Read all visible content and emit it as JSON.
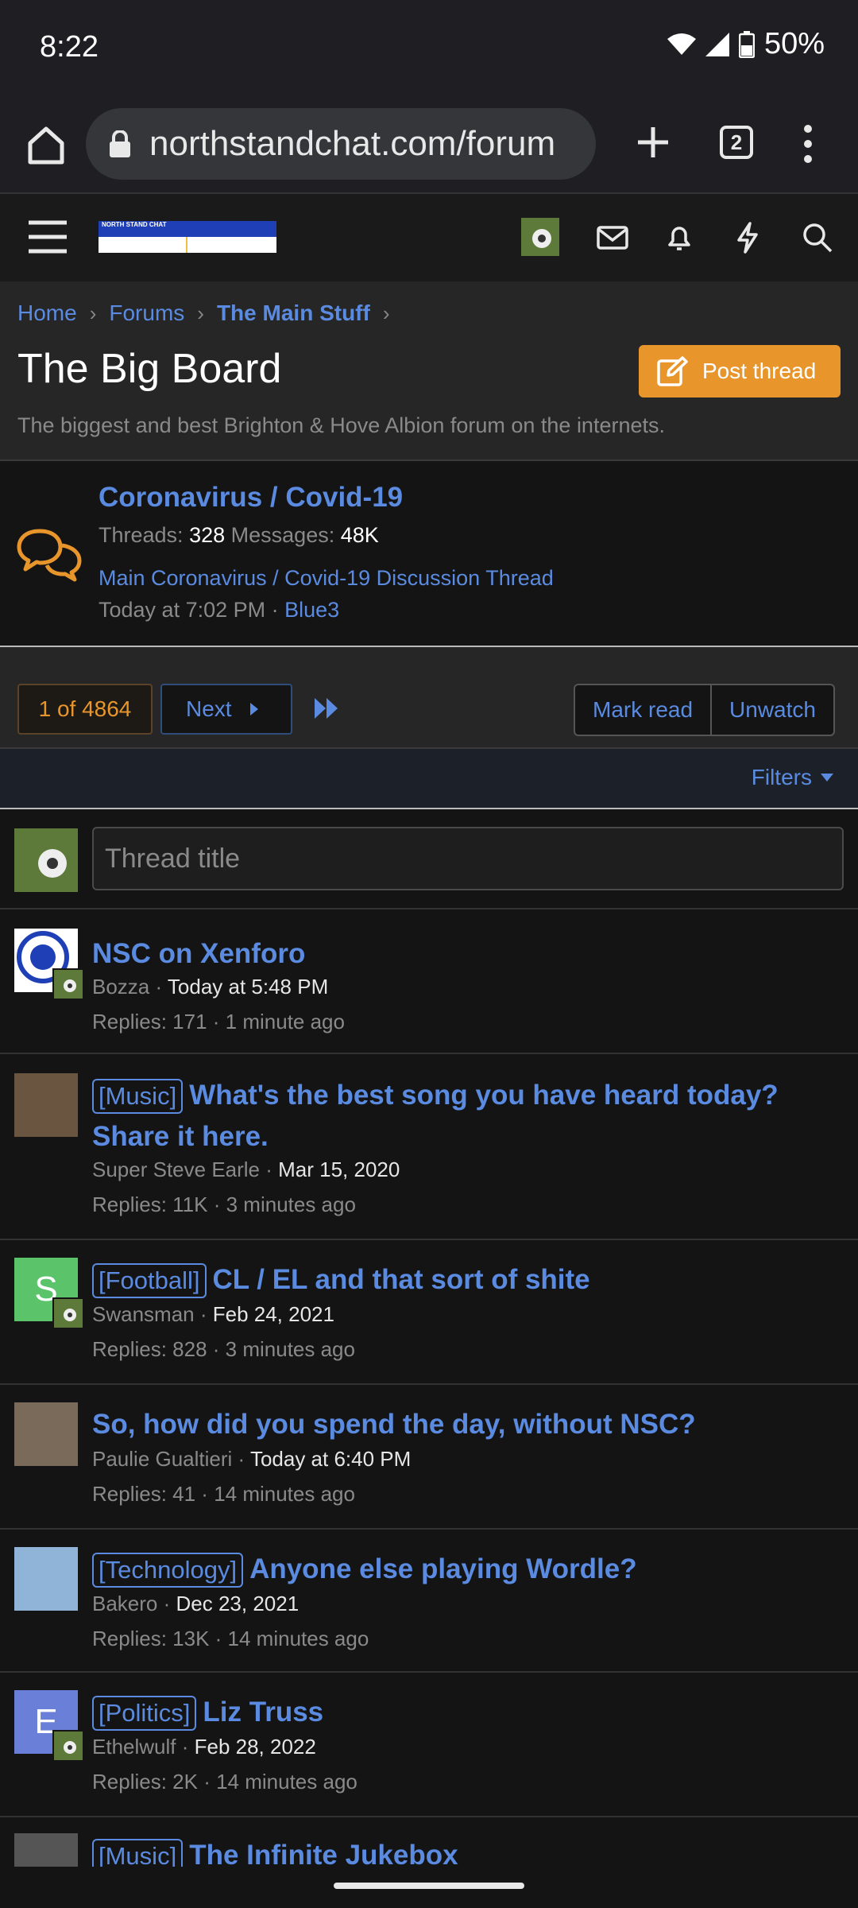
{
  "status": {
    "time": "8:22",
    "battery": "50%"
  },
  "browser": {
    "url": "northstandchat.com/forum",
    "tab_count": "2"
  },
  "header": {
    "logo_text": "NORTH STAND CHAT"
  },
  "breadcrumbs": [
    "Home",
    "Forums",
    "The Main Stuff"
  ],
  "page": {
    "title": "The Big Board",
    "post_thread_label": "Post thread",
    "description": "The biggest and best Brighton & Hove Albion forum on the internets."
  },
  "node": {
    "title": "Coronavirus / Covid-19",
    "threads_label": "Threads:",
    "threads": "328",
    "messages_label": "Messages:",
    "messages": "48K",
    "latest_thread": "Main Coronavirus / Covid-19 Discussion Thread",
    "latest_time": "Today at 7:02 PM",
    "latest_user": "Blue3"
  },
  "pagination": {
    "current": "1 of 4864",
    "next_label": "Next",
    "mark_read": "Mark read",
    "unwatch": "Unwatch",
    "filters": "Filters"
  },
  "quick_thread": {
    "placeholder": "Thread title"
  },
  "threads": [
    {
      "prefix": "",
      "title": "NSC on Xenforo",
      "author": "Bozza",
      "date": "Today at 5:48 PM",
      "replies": "Replies: 171",
      "last": "1 minute ago",
      "avatar_color": "#ffffff"
    },
    {
      "prefix": "[Music]",
      "title": "What's the best song you have heard today? Share it here.",
      "author": "Super Steve Earle",
      "date": "Mar 15, 2020",
      "replies": "Replies: 11K",
      "last": "3 minutes ago",
      "avatar_color": "#6a5640"
    },
    {
      "prefix": "[Football]",
      "title": "CL / EL and that sort of shite",
      "author": "Swansman",
      "date": "Feb 24, 2021",
      "replies": "Replies: 828",
      "last": "3 minutes ago",
      "avatar_color": "#5bc46a",
      "avatar_letter": "S"
    },
    {
      "prefix": "",
      "title": "So, how did you spend the day, without NSC?",
      "author": "Paulie Gualtieri",
      "date": "Today at 6:40 PM",
      "replies": "Replies: 41",
      "last": "14 minutes ago",
      "avatar_color": "#7a6a5a"
    },
    {
      "prefix": "[Technology]",
      "title": "Anyone else playing Wordle?",
      "author": "Bakero",
      "date": "Dec 23, 2021",
      "replies": "Replies: 13K",
      "last": "14 minutes ago",
      "avatar_color": "#8fb4d8"
    },
    {
      "prefix": "[Politics]",
      "title": "Liz Truss",
      "author": "Ethelwulf",
      "date": "Feb 28, 2022",
      "replies": "Replies: 2K",
      "last": "14 minutes ago",
      "avatar_color": "#6a7fd8",
      "avatar_letter": "E"
    },
    {
      "prefix": "[Music]",
      "title": "The Infinite Jukebox",
      "author": "",
      "date": "",
      "replies": "",
      "last": "",
      "avatar_color": "#555555"
    }
  ],
  "dot": " · "
}
